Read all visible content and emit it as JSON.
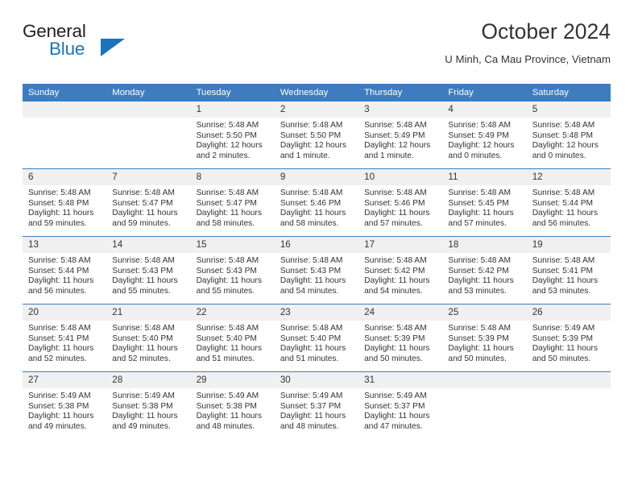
{
  "brand": {
    "name_top": "General",
    "name_bottom": "Blue",
    "accent_color": "#1b74bb"
  },
  "header": {
    "title": "October 2024",
    "subtitle": "U Minh, Ca Mau Province, Vietnam"
  },
  "theme": {
    "header_bg": "#3d7dbf",
    "daynum_bg": "#f0f0f0",
    "text": "#333333"
  },
  "weekdays": [
    "Sunday",
    "Monday",
    "Tuesday",
    "Wednesday",
    "Thursday",
    "Friday",
    "Saturday"
  ],
  "weeks": [
    [
      {
        "day": "",
        "blank": true,
        "sunrise": "",
        "sunset": "",
        "daylight": ""
      },
      {
        "day": "",
        "blank": true,
        "sunrise": "",
        "sunset": "",
        "daylight": ""
      },
      {
        "day": "1",
        "sunrise": "Sunrise: 5:48 AM",
        "sunset": "Sunset: 5:50 PM",
        "daylight": "Daylight: 12 hours and 2 minutes."
      },
      {
        "day": "2",
        "sunrise": "Sunrise: 5:48 AM",
        "sunset": "Sunset: 5:50 PM",
        "daylight": "Daylight: 12 hours and 1 minute."
      },
      {
        "day": "3",
        "sunrise": "Sunrise: 5:48 AM",
        "sunset": "Sunset: 5:49 PM",
        "daylight": "Daylight: 12 hours and 1 minute."
      },
      {
        "day": "4",
        "sunrise": "Sunrise: 5:48 AM",
        "sunset": "Sunset: 5:49 PM",
        "daylight": "Daylight: 12 hours and 0 minutes."
      },
      {
        "day": "5",
        "sunrise": "Sunrise: 5:48 AM",
        "sunset": "Sunset: 5:48 PM",
        "daylight": "Daylight: 12 hours and 0 minutes."
      }
    ],
    [
      {
        "day": "6",
        "sunrise": "Sunrise: 5:48 AM",
        "sunset": "Sunset: 5:48 PM",
        "daylight": "Daylight: 11 hours and 59 minutes."
      },
      {
        "day": "7",
        "sunrise": "Sunrise: 5:48 AM",
        "sunset": "Sunset: 5:47 PM",
        "daylight": "Daylight: 11 hours and 59 minutes."
      },
      {
        "day": "8",
        "sunrise": "Sunrise: 5:48 AM",
        "sunset": "Sunset: 5:47 PM",
        "daylight": "Daylight: 11 hours and 58 minutes."
      },
      {
        "day": "9",
        "sunrise": "Sunrise: 5:48 AM",
        "sunset": "Sunset: 5:46 PM",
        "daylight": "Daylight: 11 hours and 58 minutes."
      },
      {
        "day": "10",
        "sunrise": "Sunrise: 5:48 AM",
        "sunset": "Sunset: 5:46 PM",
        "daylight": "Daylight: 11 hours and 57 minutes."
      },
      {
        "day": "11",
        "sunrise": "Sunrise: 5:48 AM",
        "sunset": "Sunset: 5:45 PM",
        "daylight": "Daylight: 11 hours and 57 minutes."
      },
      {
        "day": "12",
        "sunrise": "Sunrise: 5:48 AM",
        "sunset": "Sunset: 5:44 PM",
        "daylight": "Daylight: 11 hours and 56 minutes."
      }
    ],
    [
      {
        "day": "13",
        "sunrise": "Sunrise: 5:48 AM",
        "sunset": "Sunset: 5:44 PM",
        "daylight": "Daylight: 11 hours and 56 minutes."
      },
      {
        "day": "14",
        "sunrise": "Sunrise: 5:48 AM",
        "sunset": "Sunset: 5:43 PM",
        "daylight": "Daylight: 11 hours and 55 minutes."
      },
      {
        "day": "15",
        "sunrise": "Sunrise: 5:48 AM",
        "sunset": "Sunset: 5:43 PM",
        "daylight": "Daylight: 11 hours and 55 minutes."
      },
      {
        "day": "16",
        "sunrise": "Sunrise: 5:48 AM",
        "sunset": "Sunset: 5:43 PM",
        "daylight": "Daylight: 11 hours and 54 minutes."
      },
      {
        "day": "17",
        "sunrise": "Sunrise: 5:48 AM",
        "sunset": "Sunset: 5:42 PM",
        "daylight": "Daylight: 11 hours and 54 minutes."
      },
      {
        "day": "18",
        "sunrise": "Sunrise: 5:48 AM",
        "sunset": "Sunset: 5:42 PM",
        "daylight": "Daylight: 11 hours and 53 minutes."
      },
      {
        "day": "19",
        "sunrise": "Sunrise: 5:48 AM",
        "sunset": "Sunset: 5:41 PM",
        "daylight": "Daylight: 11 hours and 53 minutes."
      }
    ],
    [
      {
        "day": "20",
        "sunrise": "Sunrise: 5:48 AM",
        "sunset": "Sunset: 5:41 PM",
        "daylight": "Daylight: 11 hours and 52 minutes."
      },
      {
        "day": "21",
        "sunrise": "Sunrise: 5:48 AM",
        "sunset": "Sunset: 5:40 PM",
        "daylight": "Daylight: 11 hours and 52 minutes."
      },
      {
        "day": "22",
        "sunrise": "Sunrise: 5:48 AM",
        "sunset": "Sunset: 5:40 PM",
        "daylight": "Daylight: 11 hours and 51 minutes."
      },
      {
        "day": "23",
        "sunrise": "Sunrise: 5:48 AM",
        "sunset": "Sunset: 5:40 PM",
        "daylight": "Daylight: 11 hours and 51 minutes."
      },
      {
        "day": "24",
        "sunrise": "Sunrise: 5:48 AM",
        "sunset": "Sunset: 5:39 PM",
        "daylight": "Daylight: 11 hours and 50 minutes."
      },
      {
        "day": "25",
        "sunrise": "Sunrise: 5:48 AM",
        "sunset": "Sunset: 5:39 PM",
        "daylight": "Daylight: 11 hours and 50 minutes."
      },
      {
        "day": "26",
        "sunrise": "Sunrise: 5:49 AM",
        "sunset": "Sunset: 5:39 PM",
        "daylight": "Daylight: 11 hours and 50 minutes."
      }
    ],
    [
      {
        "day": "27",
        "sunrise": "Sunrise: 5:49 AM",
        "sunset": "Sunset: 5:38 PM",
        "daylight": "Daylight: 11 hours and 49 minutes."
      },
      {
        "day": "28",
        "sunrise": "Sunrise: 5:49 AM",
        "sunset": "Sunset: 5:38 PM",
        "daylight": "Daylight: 11 hours and 49 minutes."
      },
      {
        "day": "29",
        "sunrise": "Sunrise: 5:49 AM",
        "sunset": "Sunset: 5:38 PM",
        "daylight": "Daylight: 11 hours and 48 minutes."
      },
      {
        "day": "30",
        "sunrise": "Sunrise: 5:49 AM",
        "sunset": "Sunset: 5:37 PM",
        "daylight": "Daylight: 11 hours and 48 minutes."
      },
      {
        "day": "31",
        "sunrise": "Sunrise: 5:49 AM",
        "sunset": "Sunset: 5:37 PM",
        "daylight": "Daylight: 11 hours and 47 minutes."
      },
      {
        "day": "",
        "blank": true,
        "sunrise": "",
        "sunset": "",
        "daylight": ""
      },
      {
        "day": "",
        "blank": true,
        "sunrise": "",
        "sunset": "",
        "daylight": ""
      }
    ]
  ]
}
